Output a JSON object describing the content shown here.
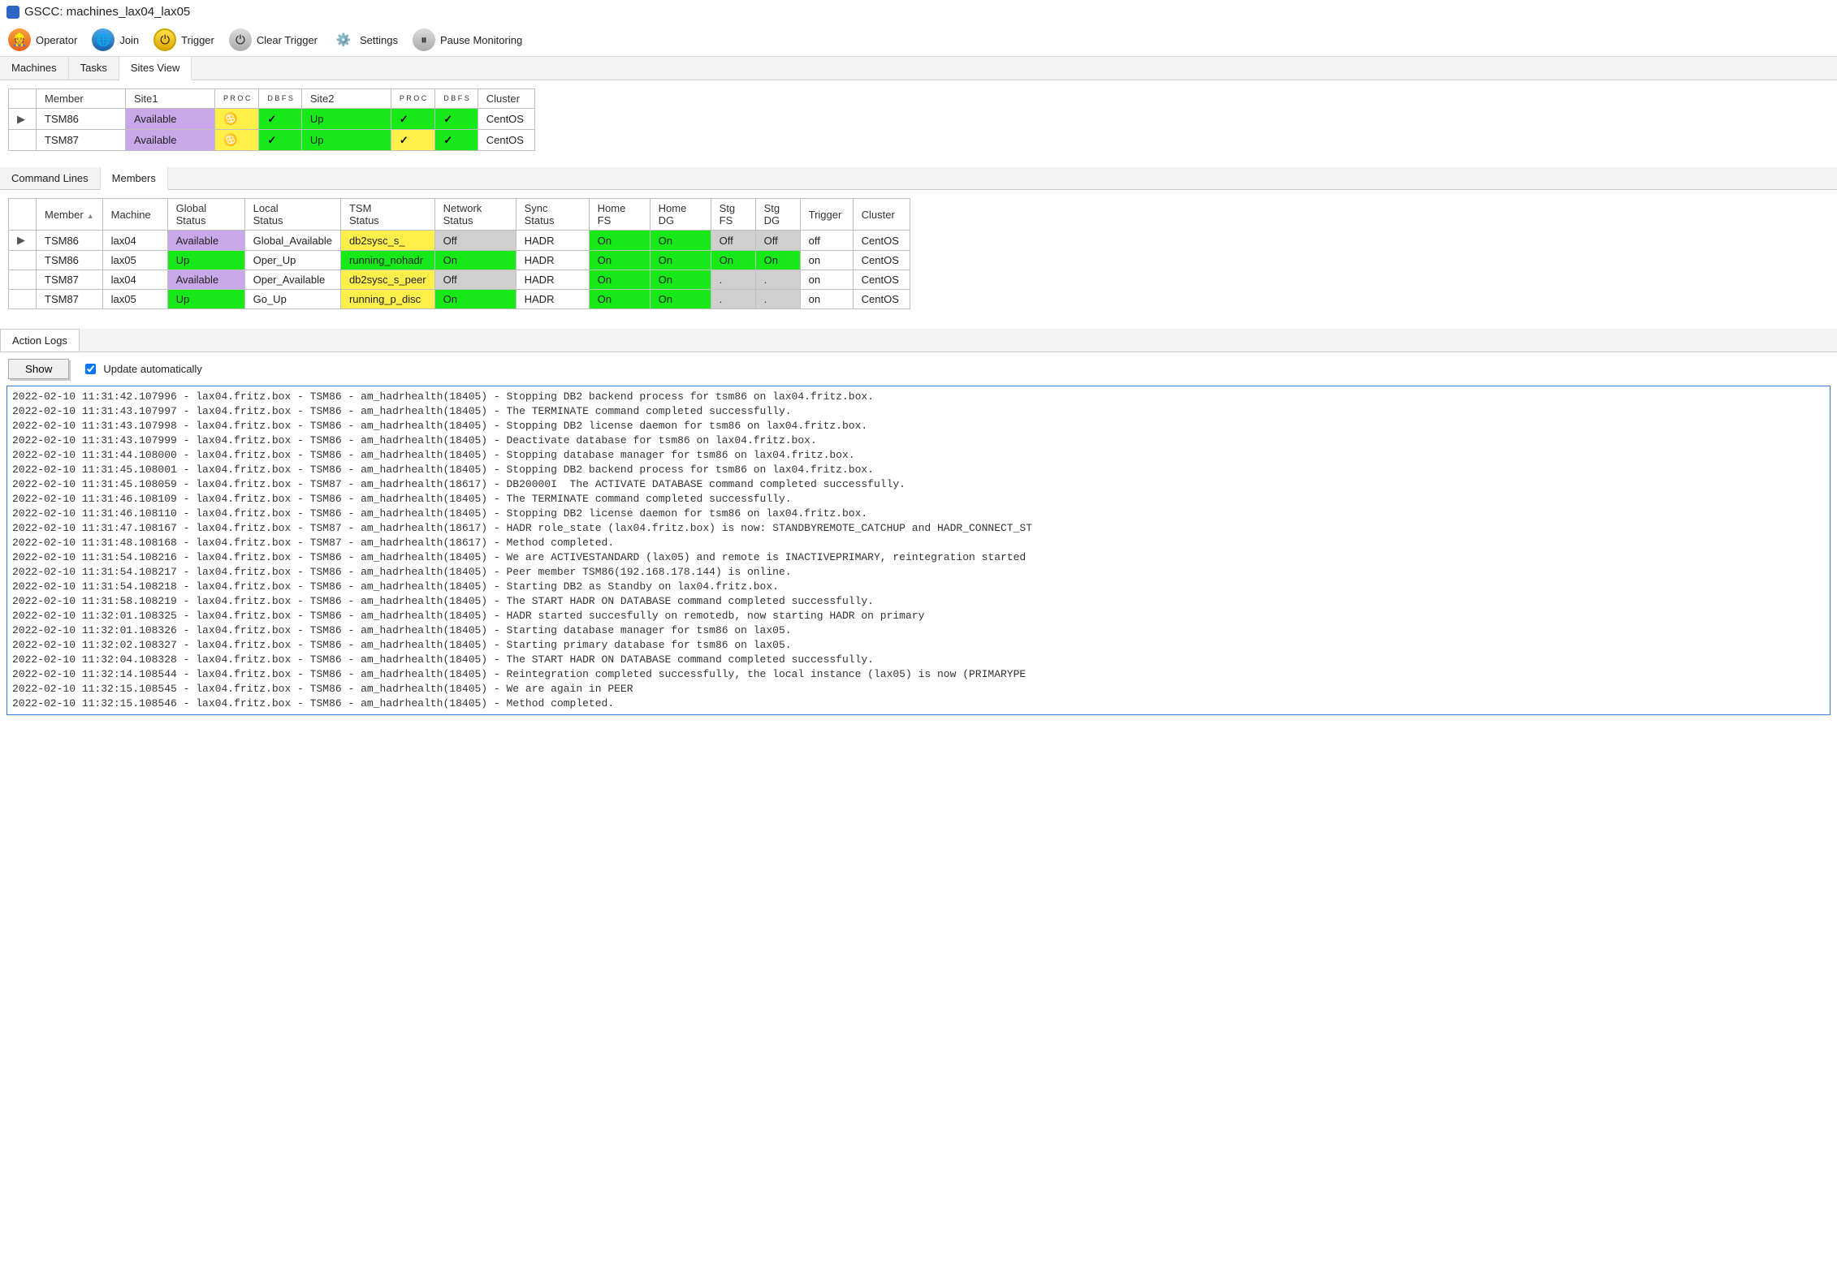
{
  "window": {
    "title": "GSCC: machines_lax04_lax05"
  },
  "toolbar": {
    "operator": "Operator",
    "join": "Join",
    "trigger": "Trigger",
    "clear_trigger": "Clear Trigger",
    "settings": "Settings",
    "pause": "Pause Monitoring"
  },
  "top_tabs": {
    "machines": "Machines",
    "tasks": "Tasks",
    "sites_view": "Sites View"
  },
  "sites_table": {
    "headers": {
      "member": "Member",
      "site1": "Site1",
      "proc": "P\nR\nO\nC",
      "dbfs": "D\nB\nF\nS",
      "site2": "Site2",
      "cluster": "Cluster"
    },
    "rows": [
      {
        "member": "TSM86",
        "site1": "Available",
        "proc1": "♋",
        "dbfs1": "✓",
        "site2": "Up",
        "proc2": "✓",
        "dbfs2": "✓",
        "cluster": "CentOS",
        "proc1_bg": "bg-yellow",
        "dbfs1_bg": "bg-green",
        "site2_bg": "bg-green",
        "proc2_bg": "bg-green",
        "dbfs2_bg": "bg-green",
        "site1_bg": "bg-purple"
      },
      {
        "member": "TSM87",
        "site1": "Available",
        "proc1": "♋",
        "dbfs1": "✓",
        "site2": "Up",
        "proc2": "✓",
        "dbfs2": "✓",
        "cluster": "CentOS",
        "proc1_bg": "bg-yellow",
        "dbfs1_bg": "bg-green",
        "site2_bg": "bg-green",
        "proc2_bg": "bg-yellow",
        "dbfs2_bg": "bg-green",
        "site1_bg": "bg-purple"
      }
    ]
  },
  "mid_tabs": {
    "command_lines": "Command Lines",
    "members": "Members"
  },
  "members_table": {
    "headers": {
      "member": "Member",
      "machine": "Machine",
      "global": "Global\nStatus",
      "local": "Local\nStatus",
      "tsm": "TSM\nStatus",
      "net": "Network\nStatus",
      "sync": "Sync\nStatus",
      "hfs": "Home\nFS",
      "hdg": "Home\nDG",
      "sfs": "Stg\nFS",
      "sdg": "Stg\nDG",
      "trigger": "Trigger",
      "cluster": "Cluster"
    },
    "rows": [
      {
        "member": "TSM86",
        "machine": "lax04",
        "global": "Available",
        "global_bg": "bg-purple",
        "local": "Global_Available",
        "tsm": "db2sysc_s_",
        "tsm_bg": "bg-yellow",
        "net": "Off",
        "net_bg": "bg-grey",
        "sync": "HADR",
        "hfs": "On",
        "hfs_bg": "bg-green",
        "hdg": "On",
        "hdg_bg": "bg-green",
        "sfs": "Off",
        "sfs_bg": "bg-grey",
        "sdg": "Off",
        "sdg_bg": "bg-grey",
        "trigger": "off",
        "cluster": "CentOS"
      },
      {
        "member": "TSM86",
        "machine": "lax05",
        "global": "Up",
        "global_bg": "bg-green",
        "local": "Oper_Up",
        "tsm": "running_nohadr",
        "tsm_bg": "bg-green",
        "net": "On",
        "net_bg": "bg-green",
        "sync": "HADR",
        "hfs": "On",
        "hfs_bg": "bg-green",
        "hdg": "On",
        "hdg_bg": "bg-green",
        "sfs": "On",
        "sfs_bg": "bg-green",
        "sdg": "On",
        "sdg_bg": "bg-green",
        "trigger": "on",
        "cluster": "CentOS"
      },
      {
        "member": "TSM87",
        "machine": "lax04",
        "global": "Available",
        "global_bg": "bg-purple",
        "local": "Oper_Available",
        "tsm": "db2sysc_s_peer",
        "tsm_bg": "bg-yellow",
        "net": "Off",
        "net_bg": "bg-grey",
        "sync": "HADR",
        "hfs": "On",
        "hfs_bg": "bg-green",
        "hdg": "On",
        "hdg_bg": "bg-green",
        "sfs": ".",
        "sfs_bg": "bg-grey",
        "sdg": ".",
        "sdg_bg": "bg-grey",
        "trigger": "on",
        "cluster": "CentOS"
      },
      {
        "member": "TSM87",
        "machine": "lax05",
        "global": "Up",
        "global_bg": "bg-green",
        "local": "Go_Up",
        "tsm": "running_p_disc",
        "tsm_bg": "bg-yellow",
        "net": "On",
        "net_bg": "bg-green",
        "sync": "HADR",
        "hfs": "On",
        "hfs_bg": "bg-green",
        "hdg": "On",
        "hdg_bg": "bg-green",
        "sfs": ".",
        "sfs_bg": "bg-grey",
        "sdg": ".",
        "sdg_bg": "bg-grey",
        "trigger": "on",
        "cluster": "CentOS"
      }
    ]
  },
  "log_tab": {
    "label": "Action Logs"
  },
  "log_toolbar": {
    "show": "Show",
    "update": "Update automatically"
  },
  "logs": [
    "2022-02-10 11:31:42.107996 - lax04.fritz.box - TSM86 - am_hadrhealth(18405) - Stopping DB2 backend process for tsm86 on lax04.fritz.box.",
    "2022-02-10 11:31:43.107997 - lax04.fritz.box - TSM86 - am_hadrhealth(18405) - The TERMINATE command completed successfully.",
    "2022-02-10 11:31:43.107998 - lax04.fritz.box - TSM86 - am_hadrhealth(18405) - Stopping DB2 license daemon for tsm86 on lax04.fritz.box.",
    "2022-02-10 11:31:43.107999 - lax04.fritz.box - TSM86 - am_hadrhealth(18405) - Deactivate database for tsm86 on lax04.fritz.box.",
    "2022-02-10 11:31:44.108000 - lax04.fritz.box - TSM86 - am_hadrhealth(18405) - Stopping database manager for tsm86 on lax04.fritz.box.",
    "2022-02-10 11:31:45.108001 - lax04.fritz.box - TSM86 - am_hadrhealth(18405) - Stopping DB2 backend process for tsm86 on lax04.fritz.box.",
    "2022-02-10 11:31:45.108059 - lax04.fritz.box - TSM87 - am_hadrhealth(18617) - DB20000I  The ACTIVATE DATABASE command completed successfully.",
    "2022-02-10 11:31:46.108109 - lax04.fritz.box - TSM86 - am_hadrhealth(18405) - The TERMINATE command completed successfully.",
    "2022-02-10 11:31:46.108110 - lax04.fritz.box - TSM86 - am_hadrhealth(18405) - Stopping DB2 license daemon for tsm86 on lax04.fritz.box.",
    "2022-02-10 11:31:47.108167 - lax04.fritz.box - TSM87 - am_hadrhealth(18617) - HADR role_state (lax04.fritz.box) is now: STANDBYREMOTE_CATCHUP and HADR_CONNECT_ST",
    "2022-02-10 11:31:48.108168 - lax04.fritz.box - TSM87 - am_hadrhealth(18617) - Method completed.",
    "2022-02-10 11:31:54.108216 - lax04.fritz.box - TSM86 - am_hadrhealth(18405) - We are ACTIVESTANDARD (lax05) and remote is INACTIVEPRIMARY, reintegration started",
    "2022-02-10 11:31:54.108217 - lax04.fritz.box - TSM86 - am_hadrhealth(18405) - Peer member TSM86(192.168.178.144) is online.",
    "2022-02-10 11:31:54.108218 - lax04.fritz.box - TSM86 - am_hadrhealth(18405) - Starting DB2 as Standby on lax04.fritz.box.",
    "2022-02-10 11:31:58.108219 - lax04.fritz.box - TSM86 - am_hadrhealth(18405) - The START HADR ON DATABASE command completed successfully.",
    "2022-02-10 11:32:01.108325 - lax04.fritz.box - TSM86 - am_hadrhealth(18405) - HADR started succesfully on remotedb, now starting HADR on primary",
    "2022-02-10 11:32:01.108326 - lax04.fritz.box - TSM86 - am_hadrhealth(18405) - Starting database manager for tsm86 on lax05.",
    "2022-02-10 11:32:02.108327 - lax04.fritz.box - TSM86 - am_hadrhealth(18405) - Starting primary database for tsm86 on lax05.",
    "2022-02-10 11:32:04.108328 - lax04.fritz.box - TSM86 - am_hadrhealth(18405) - The START HADR ON DATABASE command completed successfully.",
    "2022-02-10 11:32:14.108544 - lax04.fritz.box - TSM86 - am_hadrhealth(18405) - Reintegration completed successfully, the local instance (lax05) is now (PRIMARYPE",
    "2022-02-10 11:32:15.108545 - lax04.fritz.box - TSM86 - am_hadrhealth(18405) - We are again in PEER",
    "2022-02-10 11:32:15.108546 - lax04.fritz.box - TSM86 - am_hadrhealth(18405) - Method completed."
  ]
}
